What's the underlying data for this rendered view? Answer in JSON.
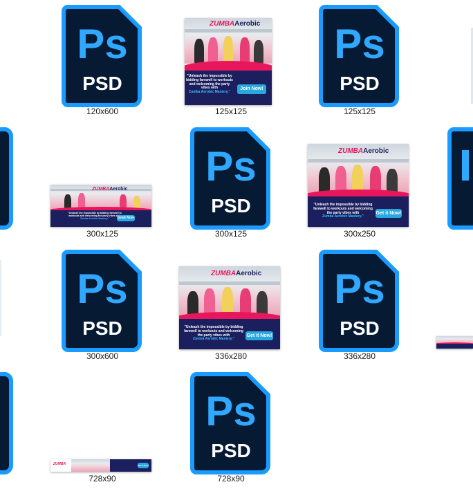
{
  "icon_type": "photoshop-psd",
  "icon_text": {
    "top": "Ps",
    "bottom": "PSD"
  },
  "colors": {
    "icon_border": "#1a9bff",
    "icon_fill": "#061a33",
    "icon_text": "#31a8ff",
    "banner_navy": "#1b1f5e",
    "banner_pink": "#e8175d",
    "cta_blue": "#29a8e0"
  },
  "banner_copy": {
    "brand_zumba": "ZUMBA",
    "brand_aerobic": "erobic",
    "brand_sub": "MASTERY",
    "tagline": "\"Unleash the impossible by bidding farewell to workouts and welcoming the party vibes with",
    "tagline_highlight": "Zumba Aerobic Mastery.\"",
    "cta_join": "Join Now!",
    "cta_grab": "Grab Now",
    "cta_get": "Get it Now!"
  },
  "files": {
    "f120x600_psd": {
      "label": "120x600"
    },
    "f125x125_jpg": {
      "label": "125x125"
    },
    "f125x125_psd": {
      "label": "125x125"
    },
    "f300x125_jpg": {
      "label": "300x125"
    },
    "f300x125_psd": {
      "label": "300x125"
    },
    "f300x250_jpg": {
      "label": "300x250"
    },
    "f300x600_psd": {
      "label": "300x600"
    },
    "f336x280_jpg": {
      "label": "336x280"
    },
    "f336x280_psd": {
      "label": "336x280"
    },
    "f728x90_jpg": {
      "label": "728x90"
    },
    "f728x90_psd": {
      "label": "728x90"
    }
  }
}
